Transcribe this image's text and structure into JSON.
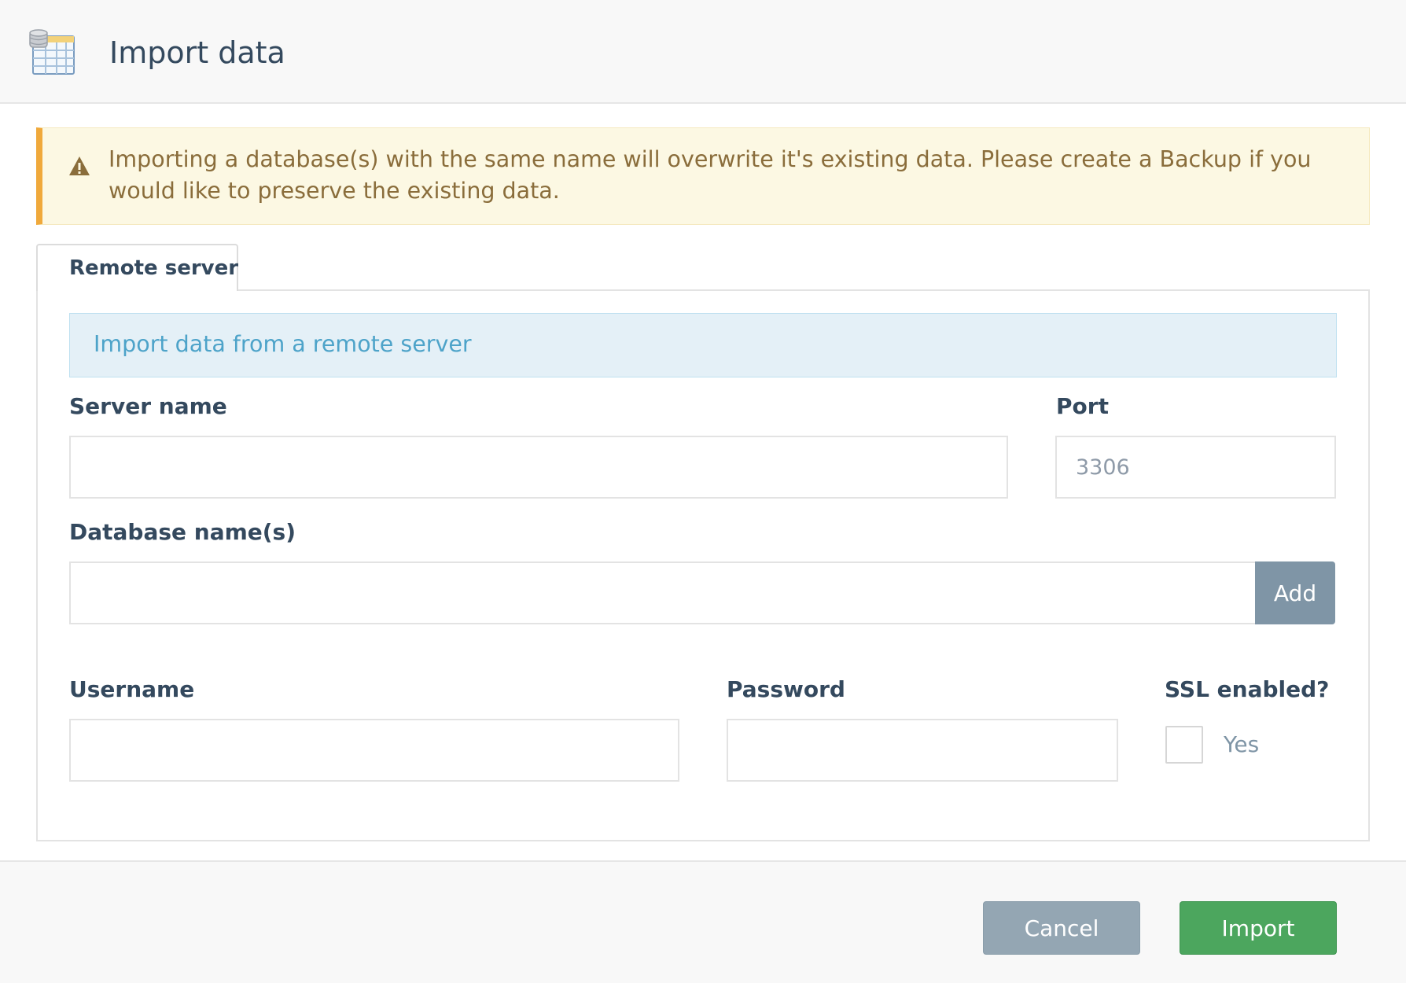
{
  "header": {
    "title": "Import data",
    "icon": "database-table-icon"
  },
  "warning": {
    "icon": "warning-triangle-icon",
    "text": "Importing a database(s) with the same name will overwrite it's existing data. Please create a Backup if you would like to preserve the existing data."
  },
  "tabs": [
    {
      "label": "Remote server",
      "active": true
    }
  ],
  "info": {
    "text": "Import data from a remote server"
  },
  "form": {
    "server_name": {
      "label": "Server name",
      "value": "",
      "placeholder": ""
    },
    "port": {
      "label": "Port",
      "value": "",
      "placeholder": "3306"
    },
    "database_names": {
      "label": "Database name(s)",
      "value": "",
      "placeholder": "",
      "add_label": "Add"
    },
    "username": {
      "label": "Username",
      "value": "",
      "placeholder": ""
    },
    "password": {
      "label": "Password",
      "value": "",
      "placeholder": ""
    },
    "ssl": {
      "label": "SSL enabled?",
      "option_label": "Yes",
      "checked": false
    }
  },
  "footer": {
    "cancel_label": "Cancel",
    "import_label": "Import"
  },
  "colors": {
    "warning_accent": "#f0a93b",
    "info_text": "#4da3c9",
    "import_button": "#4ca65e",
    "cancel_button": "#94a6b3",
    "add_button": "#7f95a6"
  }
}
